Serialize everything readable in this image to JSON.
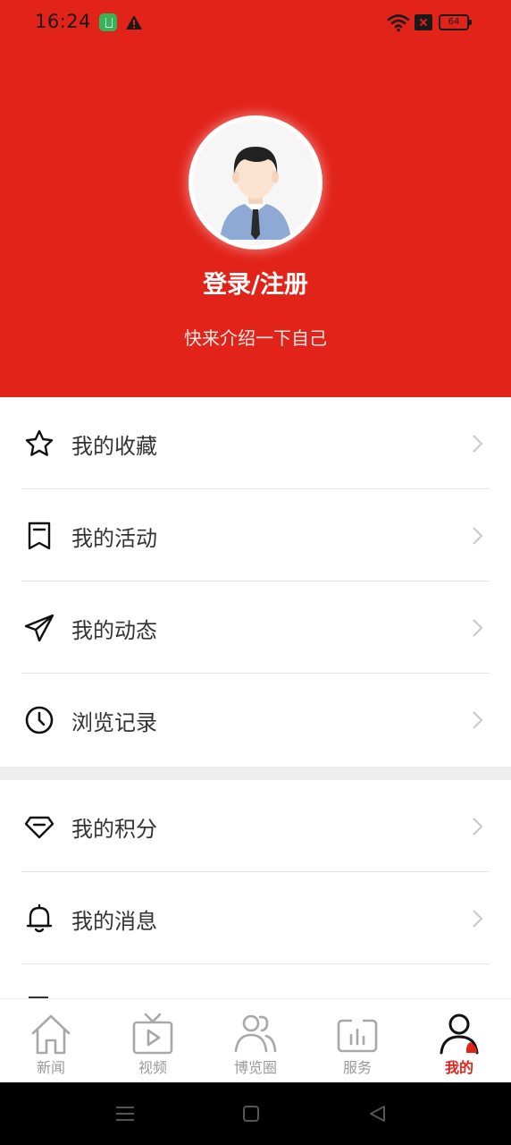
{
  "status_bar": {
    "time": "16:24",
    "battery": "64"
  },
  "profile": {
    "login_label": "登录/注册",
    "intro_label": "快来介绍一下自己"
  },
  "menu": {
    "items": [
      {
        "label": "我的收藏",
        "icon": "star-icon"
      },
      {
        "label": "我的活动",
        "icon": "bookmark-icon"
      },
      {
        "label": "我的动态",
        "icon": "send-icon"
      },
      {
        "label": "浏览记录",
        "icon": "clock-icon"
      },
      {
        "label": "我的积分",
        "icon": "diamond-icon"
      },
      {
        "label": "我的消息",
        "icon": "bell-icon"
      }
    ]
  },
  "tabbar": {
    "tabs": [
      {
        "label": "新闻",
        "icon": "home-icon"
      },
      {
        "label": "视频",
        "icon": "tv-icon"
      },
      {
        "label": "博览圈",
        "icon": "people-icon"
      },
      {
        "label": "服务",
        "icon": "chart-icon"
      },
      {
        "label": "我的",
        "icon": "user-icon",
        "active": true
      }
    ]
  },
  "colors": {
    "brand_red": "#e2231a",
    "text_dark": "#333333",
    "tab_inactive": "#999999"
  }
}
